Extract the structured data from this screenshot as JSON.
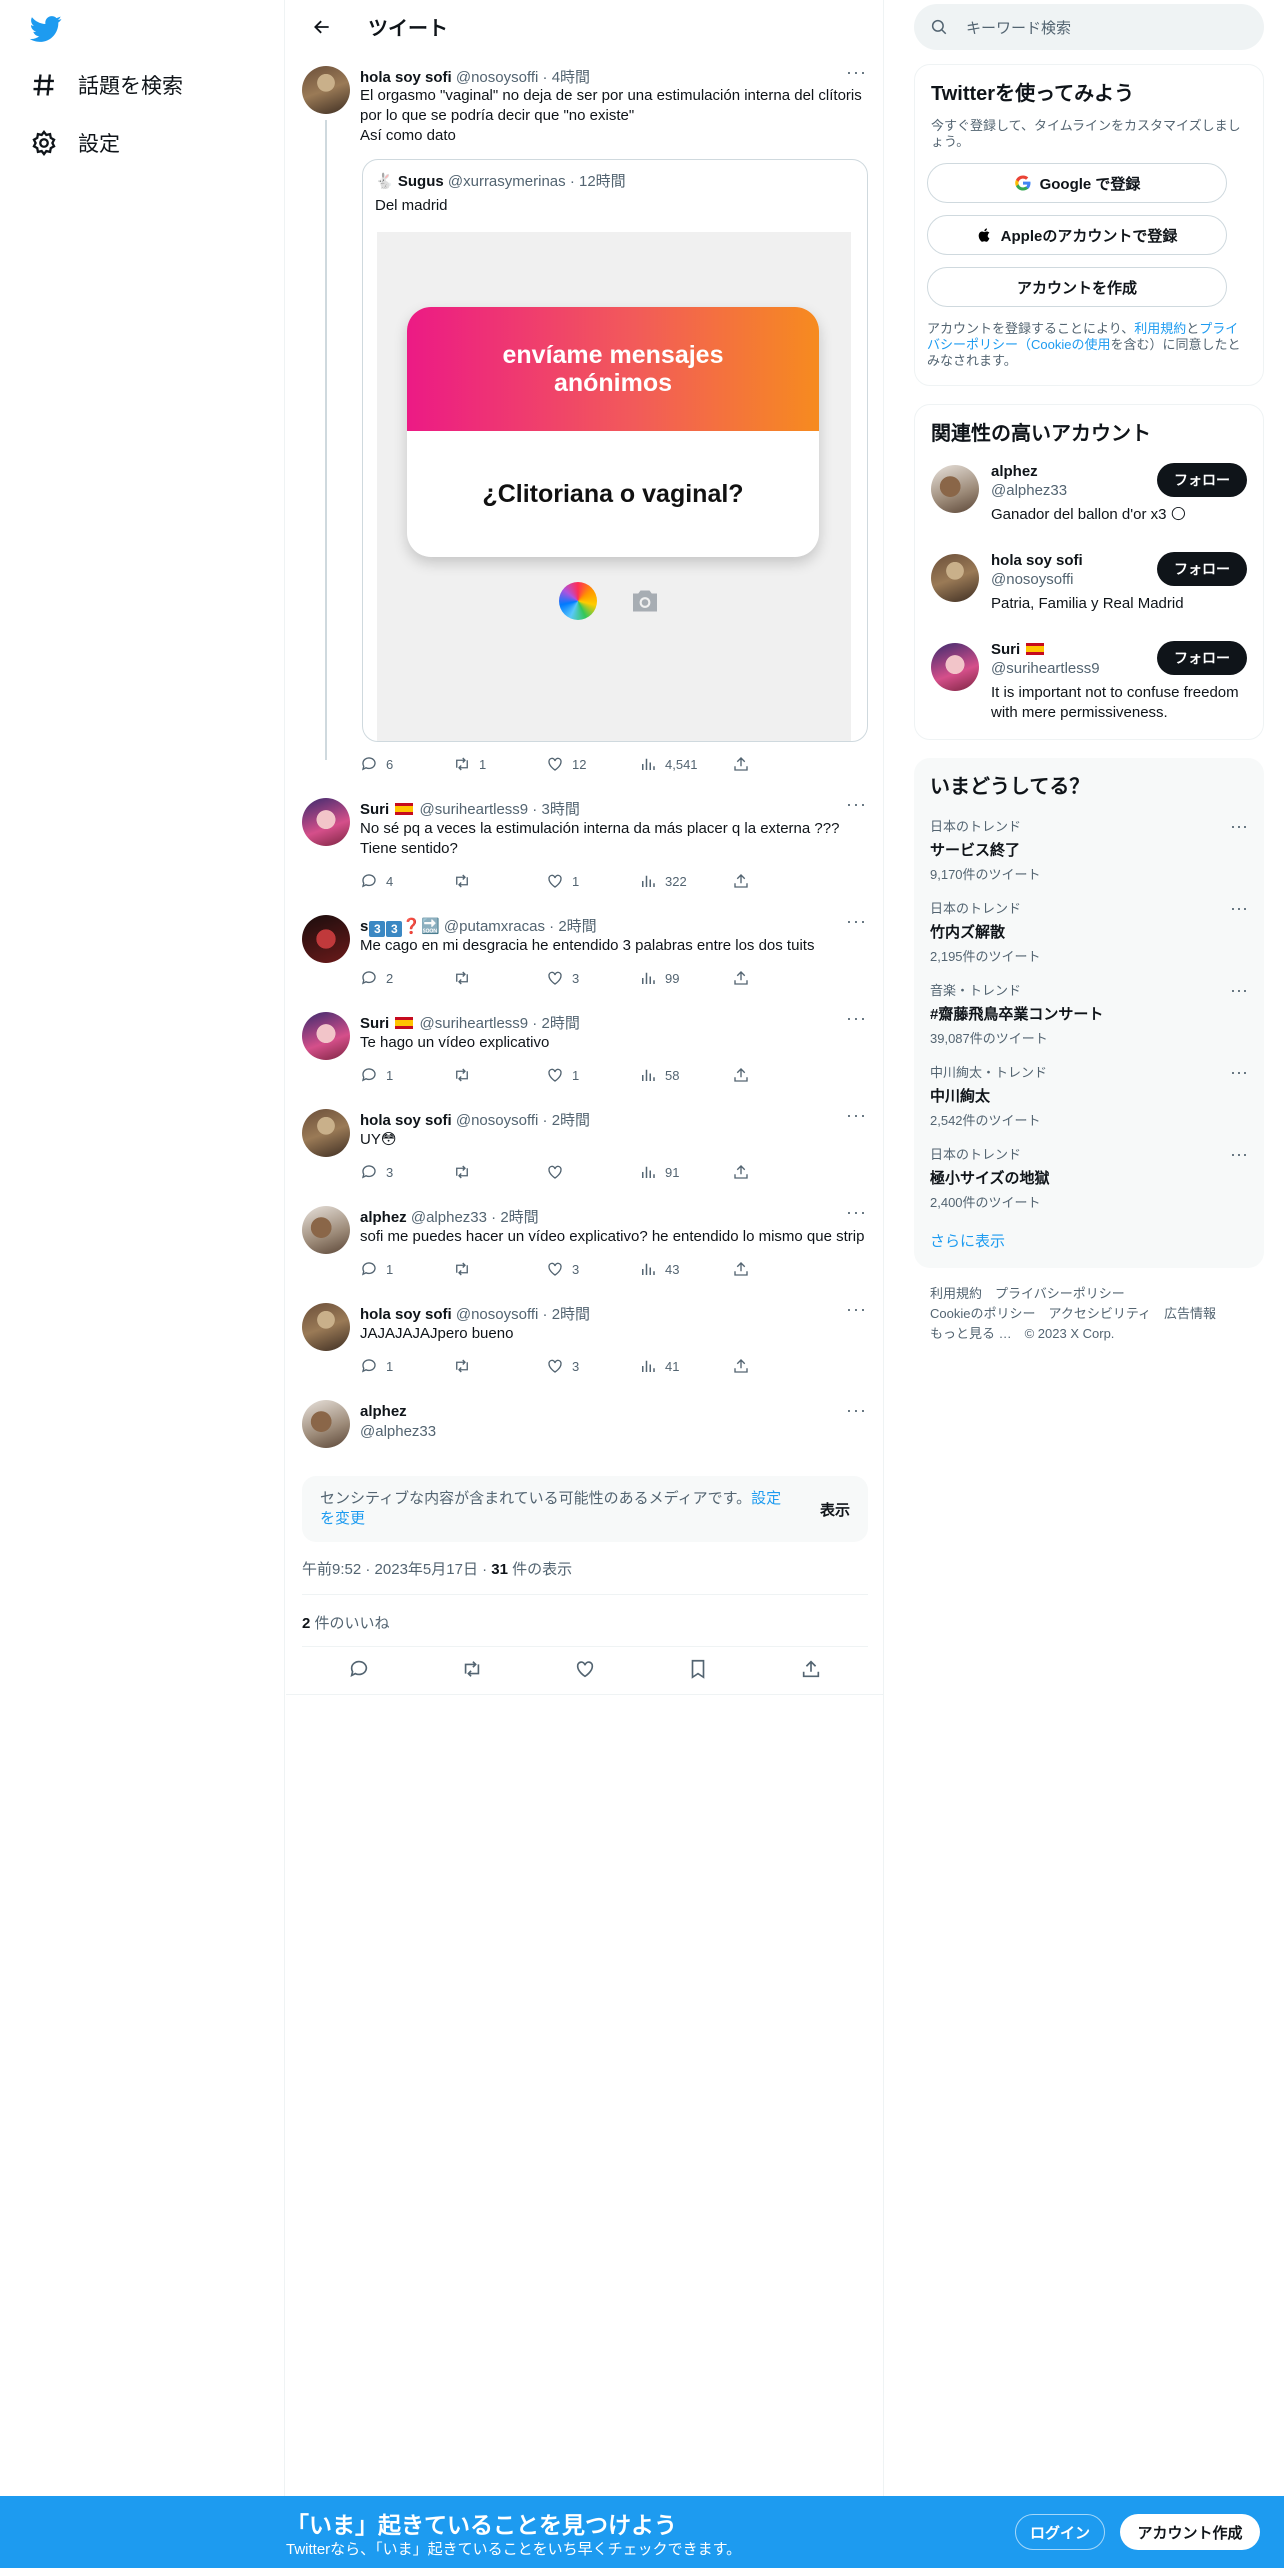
{
  "nav": {
    "explore_label": "話題を検索",
    "settings_label": "設定"
  },
  "header": {
    "title": "ツイート"
  },
  "main_tweet": {
    "name": "hola soy sofi",
    "handle": "@nosoysoffi",
    "time": "4時間",
    "text": "El orgasmo \"vaginal\" no deja de ser por una estimulación interna del clítoris por lo que se podría decir que \"no existe\"\nAsí como dato",
    "quote": {
      "emoji": "🐇",
      "name": "Sugus",
      "handle": "@xurrasymerinas",
      "time": "12時間",
      "text": "Del madrid",
      "card_top": "envíame mensajes anónimos",
      "card_bottom": "¿Clitoriana o vaginal?"
    },
    "stats": {
      "replies": "6",
      "retweets": "1",
      "likes": "12",
      "views": "4,541"
    }
  },
  "replies": [
    {
      "name": "Suri",
      "flag": true,
      "handle": "@suriheartless9",
      "time": "3時間",
      "text": "No sé pq a veces la estimulación interna da más placer q la externa ??? Tiene sentido?",
      "replies": "4",
      "retweets": "",
      "likes": "1",
      "views": "322"
    },
    {
      "name": "s",
      "handle": "@putamxracas",
      "time": "2時間",
      "text": "Me cago en mi desgracia he entendido 3 palabras entre los dos tuits",
      "replies": "2",
      "retweets": "",
      "likes": "3",
      "views": "99"
    },
    {
      "name": "Suri",
      "flag": true,
      "handle": "@suriheartless9",
      "time": "2時間",
      "text": "Te hago un vídeo explicativo",
      "replies": "1",
      "retweets": "",
      "likes": "1",
      "views": "58"
    },
    {
      "name": "hola soy sofi",
      "handle": "@nosoysoffi",
      "time": "2時間",
      "text": "UY😳",
      "replies": "3",
      "retweets": "",
      "likes": "",
      "views": "91"
    },
    {
      "name": "alphez",
      "handle": "@alphez33",
      "time": "2時間",
      "text": "sofi me puedes hacer un vídeo explicativo? he entendido lo mismo que strip",
      "replies": "1",
      "retweets": "",
      "likes": "3",
      "views": "43"
    },
    {
      "name": "hola soy sofi",
      "handle": "@nosoysoffi",
      "time": "2時間",
      "text": "JAJAJAJAJpero bueno",
      "replies": "1",
      "retweets": "",
      "likes": "3",
      "views": "41"
    }
  ],
  "s_name_extra": {
    "box1": "3",
    "box2": "3",
    "mark": "❓",
    "soon": "🔜"
  },
  "focused": {
    "name": "alphez",
    "handle": "@alphez33",
    "sensitive_text": "センシティブな内容が含まれている可能性のあるメディアです。",
    "sensitive_link": "設定を変更",
    "show_label": "表示",
    "time": "午前9:52",
    "date": "2023年5月17日",
    "views_count": "31",
    "views_label": "件の表示",
    "likes_count": "2",
    "likes_label": "件のいいね"
  },
  "sidebar": {
    "search_placeholder": "キーワード検索",
    "signup": {
      "title": "Twitterを使ってみよう",
      "subtitle": "今すぐ登録して、タイムラインをカスタマイズしましょう。",
      "google": "Google で登録",
      "apple": "Appleのアカウントで登録",
      "create": "アカウントを作成",
      "terms_1": "アカウントを登録することにより、",
      "terms_link_1": "利用規約",
      "terms_2": "と",
      "terms_link_2": "プライバシーポリシー（Cookieの使用",
      "terms_3": "を含む）に同意したとみなされます。"
    },
    "relevant": {
      "title": "関連性の高いアカウント",
      "follow": "フォロー",
      "accounts": [
        {
          "name": "alphez",
          "handle": "@alphez33",
          "bio": "Ganador del ballon d'or x3 🌕"
        },
        {
          "name": "hola soy sofi",
          "handle": "@nosoysoffi",
          "bio": "Patria, Familia y Real Madrid"
        },
        {
          "name": "Suri",
          "handle": "@suriheartless9",
          "bio": "It is important not to confuse freedom with mere permissiveness."
        }
      ]
    },
    "trends": {
      "title": "いまどうしてる？",
      "items": [
        {
          "context": "日本のトレンド",
          "topic": "サービス終了",
          "count": "9,170件のツイート"
        },
        {
          "context": "日本のトレンド",
          "topic": "竹内ズ解散",
          "count": "2,195件のツイート"
        },
        {
          "context": "音楽・トレンド",
          "topic": "#齋藤飛鳥卒業コンサート",
          "count": "39,087件のツイート"
        },
        {
          "context": "中川絢太・トレンド",
          "topic": "中川絢太",
          "count": "2,542件のツイート"
        },
        {
          "context": "日本のトレンド",
          "topic": "極小サイズの地獄",
          "count": "2,400件のツイート"
        }
      ],
      "more": "さらに表示"
    },
    "footer": {
      "line1": "利用規約　プライバシーポリシー",
      "line2": "Cookieのポリシー　アクセシビリティ　広告情報",
      "line3": "もっと見る …　© 2023 X Corp."
    }
  },
  "bottom_bar": {
    "headline": "「いま」起きていることを見つけよう",
    "subline": "Twitterなら、「いま」起きていることをいち早くチェックできます。",
    "login": "ログイン",
    "signup": "アカウント作成"
  },
  "colors": {
    "accent": "#1d9bf0",
    "text": "#0f1419",
    "muted": "#536471"
  }
}
